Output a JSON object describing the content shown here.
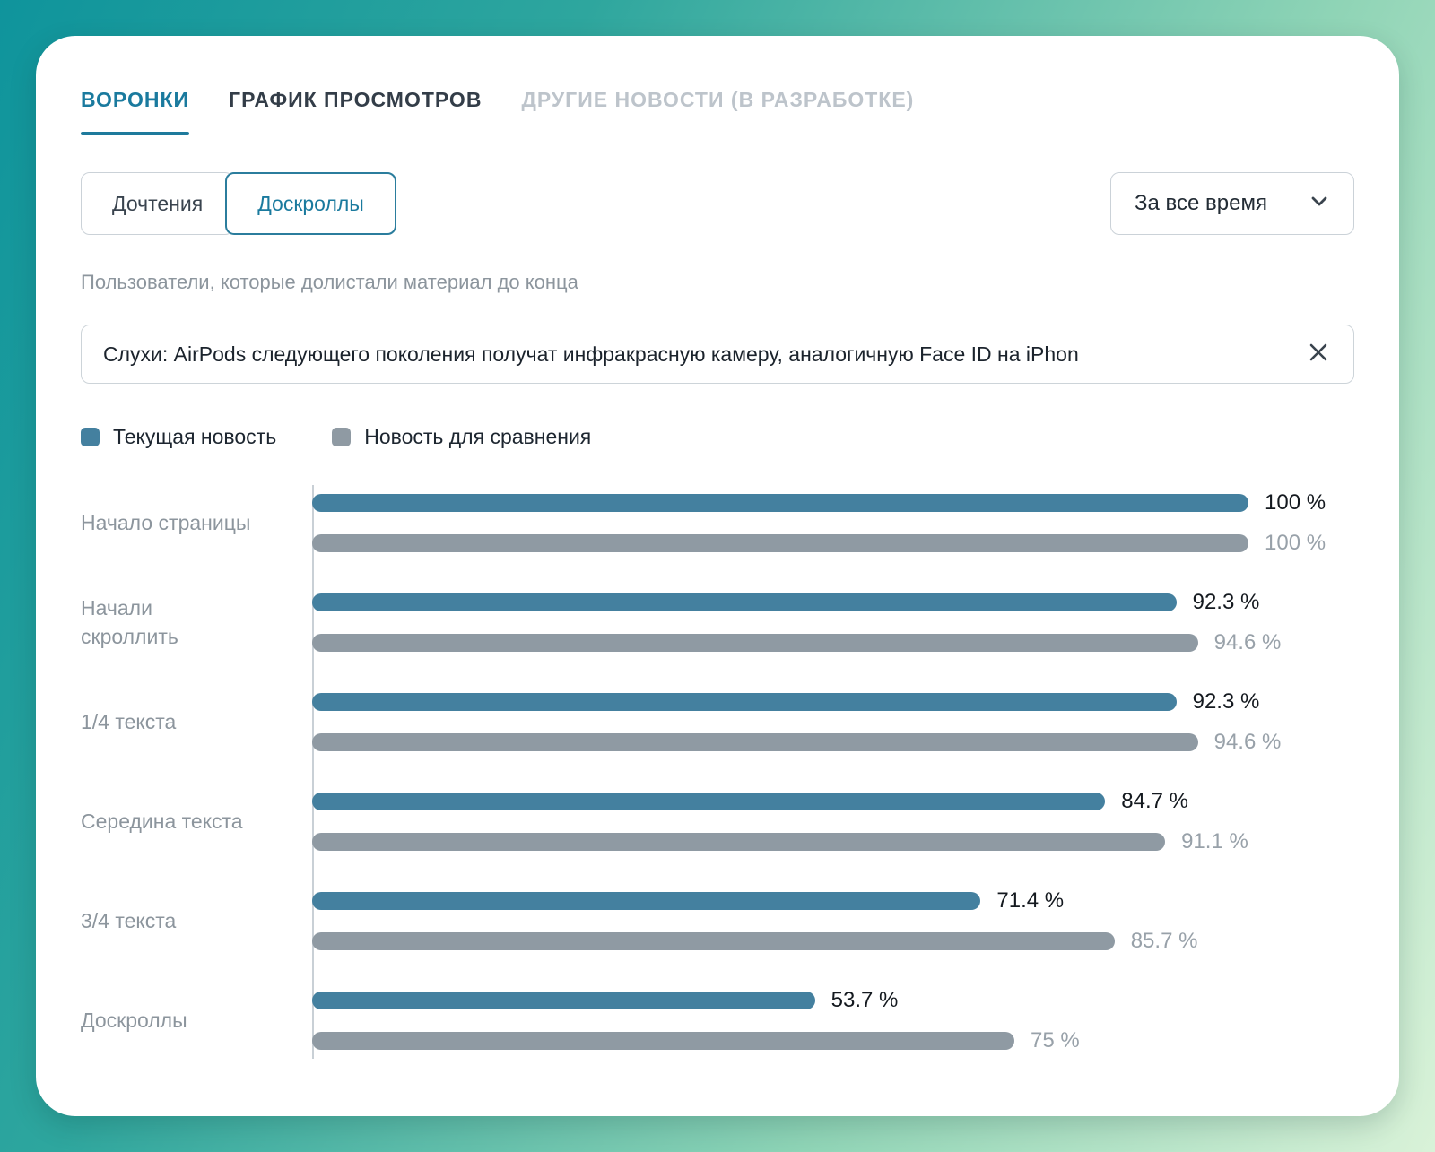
{
  "tabs": [
    {
      "label": "ВОРОНКИ",
      "state": "active"
    },
    {
      "label": "ГРАФИК ПРОСМОТРОВ",
      "state": "normal"
    },
    {
      "label": "ДРУГИЕ НОВОСТИ (В РАЗРАБОТКЕ)",
      "state": "disabled"
    }
  ],
  "filters": {
    "toggle_options": [
      {
        "label": "Дочтения",
        "active": false
      },
      {
        "label": "Доскроллы",
        "active": true
      }
    ],
    "period": "За все время"
  },
  "subtitle": "Пользователи, которые долистали материал до конца",
  "article_filter": {
    "value": "Слухи: AirPods следующего поколения получат инфракрасную камеру, аналогичную Face ID на iPhon"
  },
  "legend": [
    {
      "label": "Текущая новость",
      "color": "#44809F"
    },
    {
      "label": "Новость для сравнения",
      "color": "#8F9AA3"
    }
  ],
  "chart_data": {
    "type": "bar",
    "orientation": "horizontal",
    "categories": [
      "Начало страницы",
      "Начали\nскроллить",
      "1/4 текста",
      "Середина текста",
      "3/4 текста",
      "Доскроллы"
    ],
    "series": [
      {
        "name": "Текущая новость",
        "color": "#44809F",
        "values": [
          100,
          92.3,
          92.3,
          84.7,
          71.4,
          53.7
        ],
        "value_labels": [
          "100 %",
          "92.3 %",
          "92.3 %",
          "84.7 %",
          "71.4 %",
          "53.7 %"
        ]
      },
      {
        "name": "Новость для сравнения",
        "color": "#8F9AA3",
        "values": [
          100,
          94.6,
          94.6,
          91.1,
          85.7,
          75
        ],
        "value_labels": [
          "100 %",
          "94.6 %",
          "94.6 %",
          "91.1 %",
          "85.7 %",
          "75 %"
        ]
      }
    ],
    "xlim": [
      0,
      100
    ],
    "grid": false,
    "legend_position": "top"
  }
}
